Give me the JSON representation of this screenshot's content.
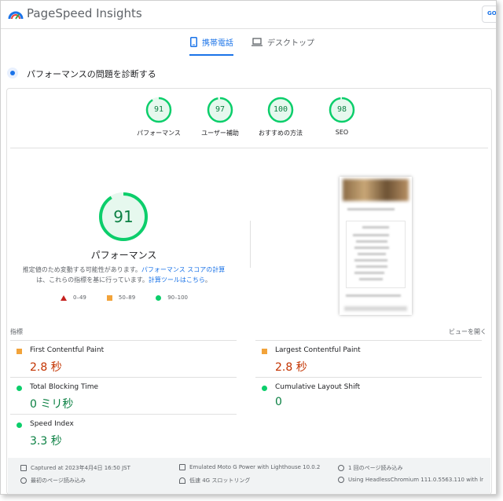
{
  "brand": {
    "title": "PageSpeed Insights",
    "button_label": "GO"
  },
  "tabs": [
    {
      "label": "携帯電話",
      "icon": "phone-icon",
      "active": true
    },
    {
      "label": "デスクトップ",
      "icon": "laptop-icon",
      "active": false
    }
  ],
  "diagnose": {
    "text": "パフォーマンスの問題を診断する"
  },
  "scores": [
    {
      "value": "91",
      "label": "パフォーマンス",
      "fraction": 0.91
    },
    {
      "value": "97",
      "label": "ユーザー補助",
      "fraction": 0.97
    },
    {
      "value": "100",
      "label": "おすすめの方法",
      "fraction": 1.0
    },
    {
      "value": "98",
      "label": "SEO",
      "fraction": 0.98
    }
  ],
  "performance": {
    "score": "91",
    "fraction": 0.91,
    "label": "パフォーマンス",
    "note_prefix": "推定値のため変動する可能性があります。",
    "note_link1": "パフォーマンス スコアの計算",
    "note_mid": "は、これらの指標を基に行っています。",
    "note_link2": "計算ツールはこちら",
    "note_suffix": "。"
  },
  "legend": [
    {
      "shape": "triangle",
      "label": "0–49",
      "color": "#c5221f"
    },
    {
      "shape": "square",
      "label": "50–89",
      "color": "#f2a33a"
    },
    {
      "shape": "circle",
      "label": "90–100",
      "color": "#0cce6b"
    }
  ],
  "metrics_section": {
    "title": "指標",
    "expand_label": "ビューを開く"
  },
  "metrics": [
    {
      "name": "First Contentful Paint",
      "value": "2.8 秒",
      "status": "orange"
    },
    {
      "name": "Largest Contentful Paint",
      "value": "2.8 秒",
      "status": "orange"
    },
    {
      "name": "Total Blocking Time",
      "value": "0 ミリ秒",
      "status": "green"
    },
    {
      "name": "Cumulative Layout Shift",
      "value": "0",
      "status": "green"
    },
    {
      "name": "Speed Index",
      "value": "3.3 秒",
      "status": "green"
    }
  ],
  "footer": {
    "captured": "Captured at 2023年4月4日 16:50 JST",
    "device": "Emulated Moto G Power with Lighthouse 10.0.2",
    "page_loads": "1 回のページ読み込み",
    "first_load": "最初のページ読み込み",
    "throttling": "低速 4G スロットリング",
    "browser": "Using HeadlessChromium 111.0.5563.110 with lr"
  },
  "colors": {
    "accent": "#1a73e8",
    "pass": "#0cce6b",
    "average": "#f2a33a",
    "fail": "#c5221f"
  }
}
